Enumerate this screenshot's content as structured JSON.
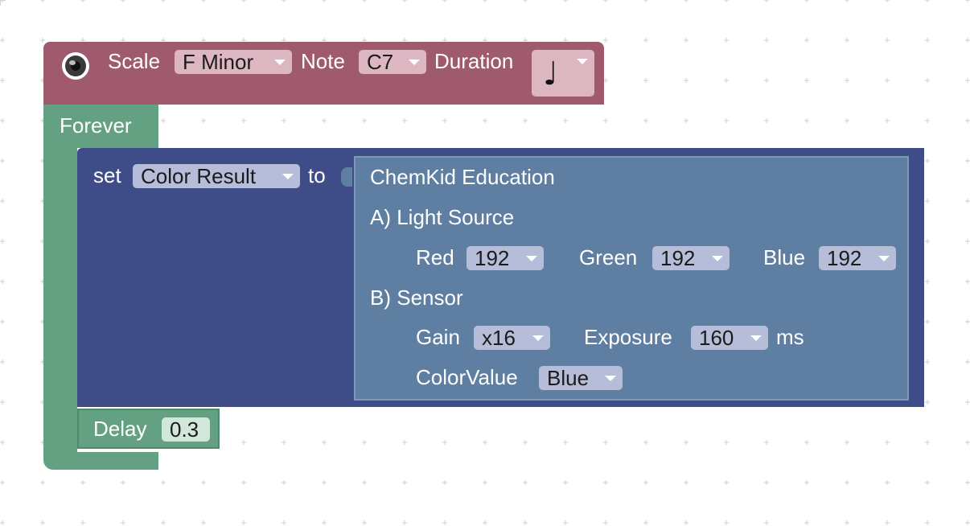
{
  "colors": {
    "music_block": "#a05a6e",
    "forever_block": "#64a183",
    "set_block": "#3e4d87",
    "chemkid_block": "#5f7fa2",
    "workspace_bg": "#ffffff",
    "grid_dot": "#cfcfcf"
  },
  "music": {
    "icon": "speaker-icon",
    "scale_label": "Scale",
    "scale_value": "F Minor",
    "note_label": "Note",
    "note_value": "C7",
    "duration_label": "Duration",
    "duration_icon": "quarter-note-icon",
    "duration_symbol": "♩"
  },
  "forever": {
    "label": "Forever"
  },
  "set": {
    "label": "set",
    "variable": "Color Result",
    "to_label": "to"
  },
  "chemkid": {
    "title": "ChemKid Education",
    "light_source_label": "A) Light Source",
    "red_label": "Red",
    "red_value": "192",
    "green_label": "Green",
    "green_value": "192",
    "blue_label": "Blue",
    "blue_value": "192",
    "sensor_label": "B) Sensor",
    "gain_label": "Gain",
    "gain_value": "x16",
    "exposure_label": "Exposure",
    "exposure_value": "160",
    "exposure_unit": "ms",
    "colorvalue_label": "ColorValue",
    "colorvalue_value": "Blue"
  },
  "delay": {
    "label": "Delay",
    "value": "0.3"
  }
}
